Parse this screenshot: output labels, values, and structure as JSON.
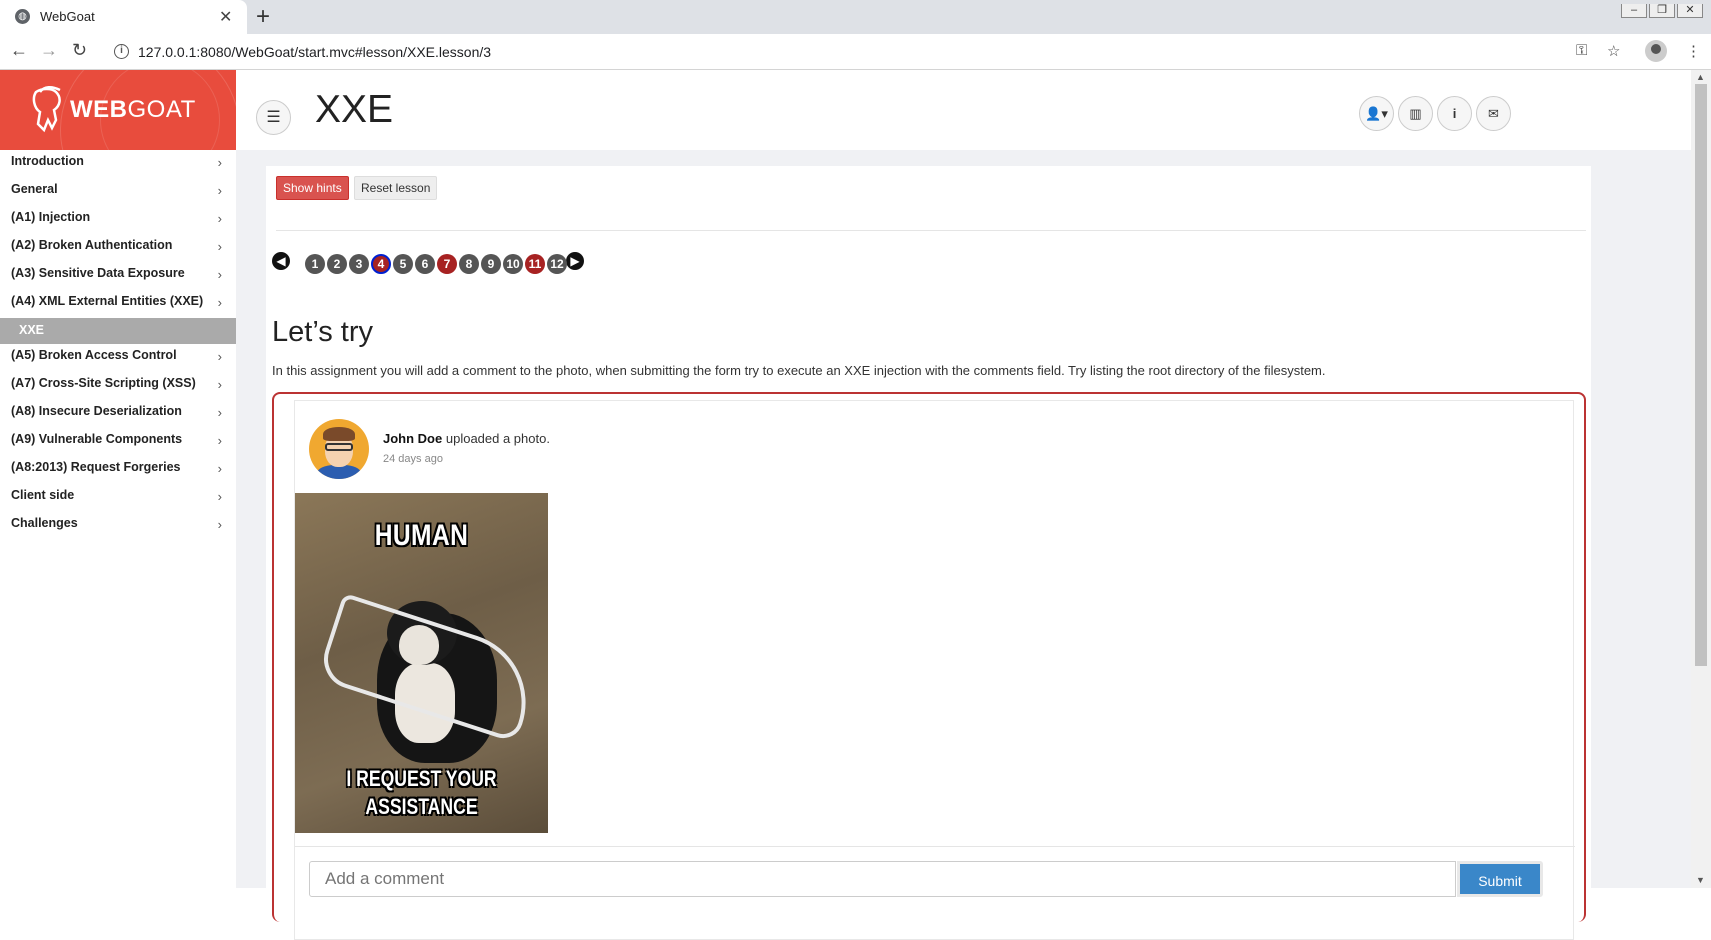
{
  "browser": {
    "tab_title": "WebGoat",
    "url": "127.0.0.1:8080/WebGoat/start.mvc#lesson/XXE.lesson/3"
  },
  "brand": {
    "name_bold": "WEB",
    "name_rest": "GOAT"
  },
  "sidebar": {
    "items": [
      {
        "label": "Introduction"
      },
      {
        "label": "General"
      },
      {
        "label": "(A1) Injection"
      },
      {
        "label": "(A2) Broken Authentication"
      },
      {
        "label": "(A3) Sensitive Data Exposure"
      },
      {
        "label": "(A4) XML External Entities (XXE)"
      },
      {
        "label": "XXE",
        "active": true
      },
      {
        "label": "(A5) Broken Access Control"
      },
      {
        "label": "(A7) Cross-Site Scripting (XSS)"
      },
      {
        "label": "(A8) Insecure Deserialization"
      },
      {
        "label": "(A9) Vulnerable Components"
      },
      {
        "label": "(A8:2013) Request Forgeries"
      },
      {
        "label": "Client side"
      },
      {
        "label": "Challenges"
      }
    ]
  },
  "header": {
    "title": "XXE"
  },
  "lesson": {
    "show_hints": "Show hints",
    "reset_lesson": "Reset lesson",
    "pages": [
      "1",
      "2",
      "3",
      "4",
      "5",
      "6",
      "7",
      "8",
      "9",
      "10",
      "11",
      "12"
    ],
    "current_page": "4",
    "completed_pages": [
      "7",
      "11"
    ],
    "subtitle": "Let’s try",
    "description": "In this assignment you will add a comment to the photo, when submitting the form try to execute an XXE injection with the comments field. Try listing the root directory of the filesystem."
  },
  "post": {
    "author": "John Doe",
    "action": "uploaded a photo.",
    "time": "24 days ago",
    "meme_top": "HUMAN",
    "meme_bottom_1": "I REQUEST YOUR",
    "meme_bottom_2": "ASSISTANCE",
    "comment_placeholder": "Add a comment",
    "submit_label": "Submit"
  },
  "colors": {
    "brand": "#e84c3d",
    "danger": "#d9534f",
    "primary": "#3a87c9",
    "done": "#a72222"
  }
}
